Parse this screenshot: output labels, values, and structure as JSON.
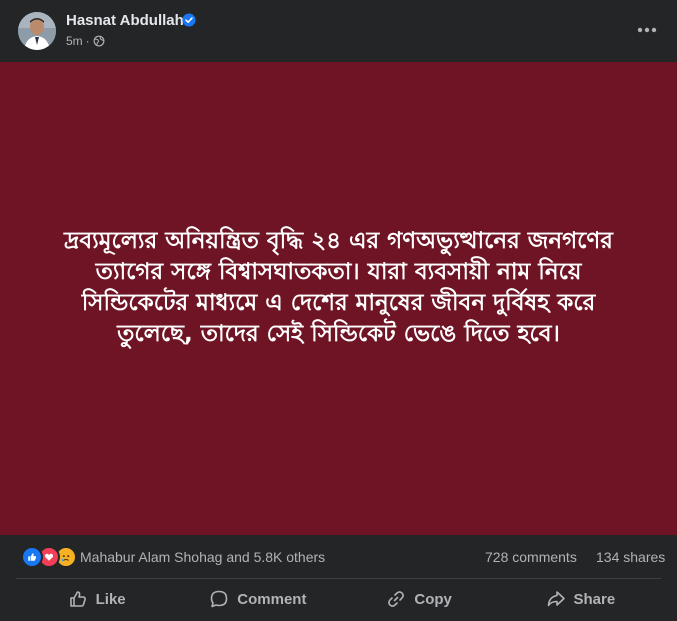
{
  "post": {
    "author": "Hasnat Abdullah",
    "time": "5m",
    "dot": "·",
    "body_text": "দ্রব্যমূল্যের অনিয়ন্ত্রিত বৃদ্ধি ২৪ এর গণঅভ্যুত্থানের জনগণের ত্যাগের সঙ্গে বিশ্বাসঘাতকতা। যারা ব্যবসায়ী নাম নিয়ে সিন্ডিকেটের মাধ্যমে এ দেশের মানুষের জীবন দুর্বিষহ করে তুলেছে, তাদের সেই সিন্ডিকেট ভেঙে দিতে হবে।",
    "image_background": "#6f1424"
  },
  "stats": {
    "reaction_names": "Mahabur Alam Shohag and 5.8K others",
    "comments": "728 comments",
    "shares": "134 shares"
  },
  "actions": {
    "like": "Like",
    "comment": "Comment",
    "copy": "Copy",
    "share": "Share"
  },
  "colors": {
    "background": "#242526",
    "text_primary": "#e4e6eb",
    "text_secondary": "#b0b3b8",
    "verified_blue": "#1877f2",
    "like_blue": "#1877f2",
    "love_red": "#f33e58",
    "sad_yellow": "#f7b125"
  },
  "icons": {
    "verified": "verified-badge-icon",
    "audience": "globe-icon",
    "more": "more-horizontal-icon",
    "like": "thumbs-up-icon",
    "comment": "comment-bubble-icon",
    "copy": "link-icon",
    "share": "share-arrow-icon"
  }
}
